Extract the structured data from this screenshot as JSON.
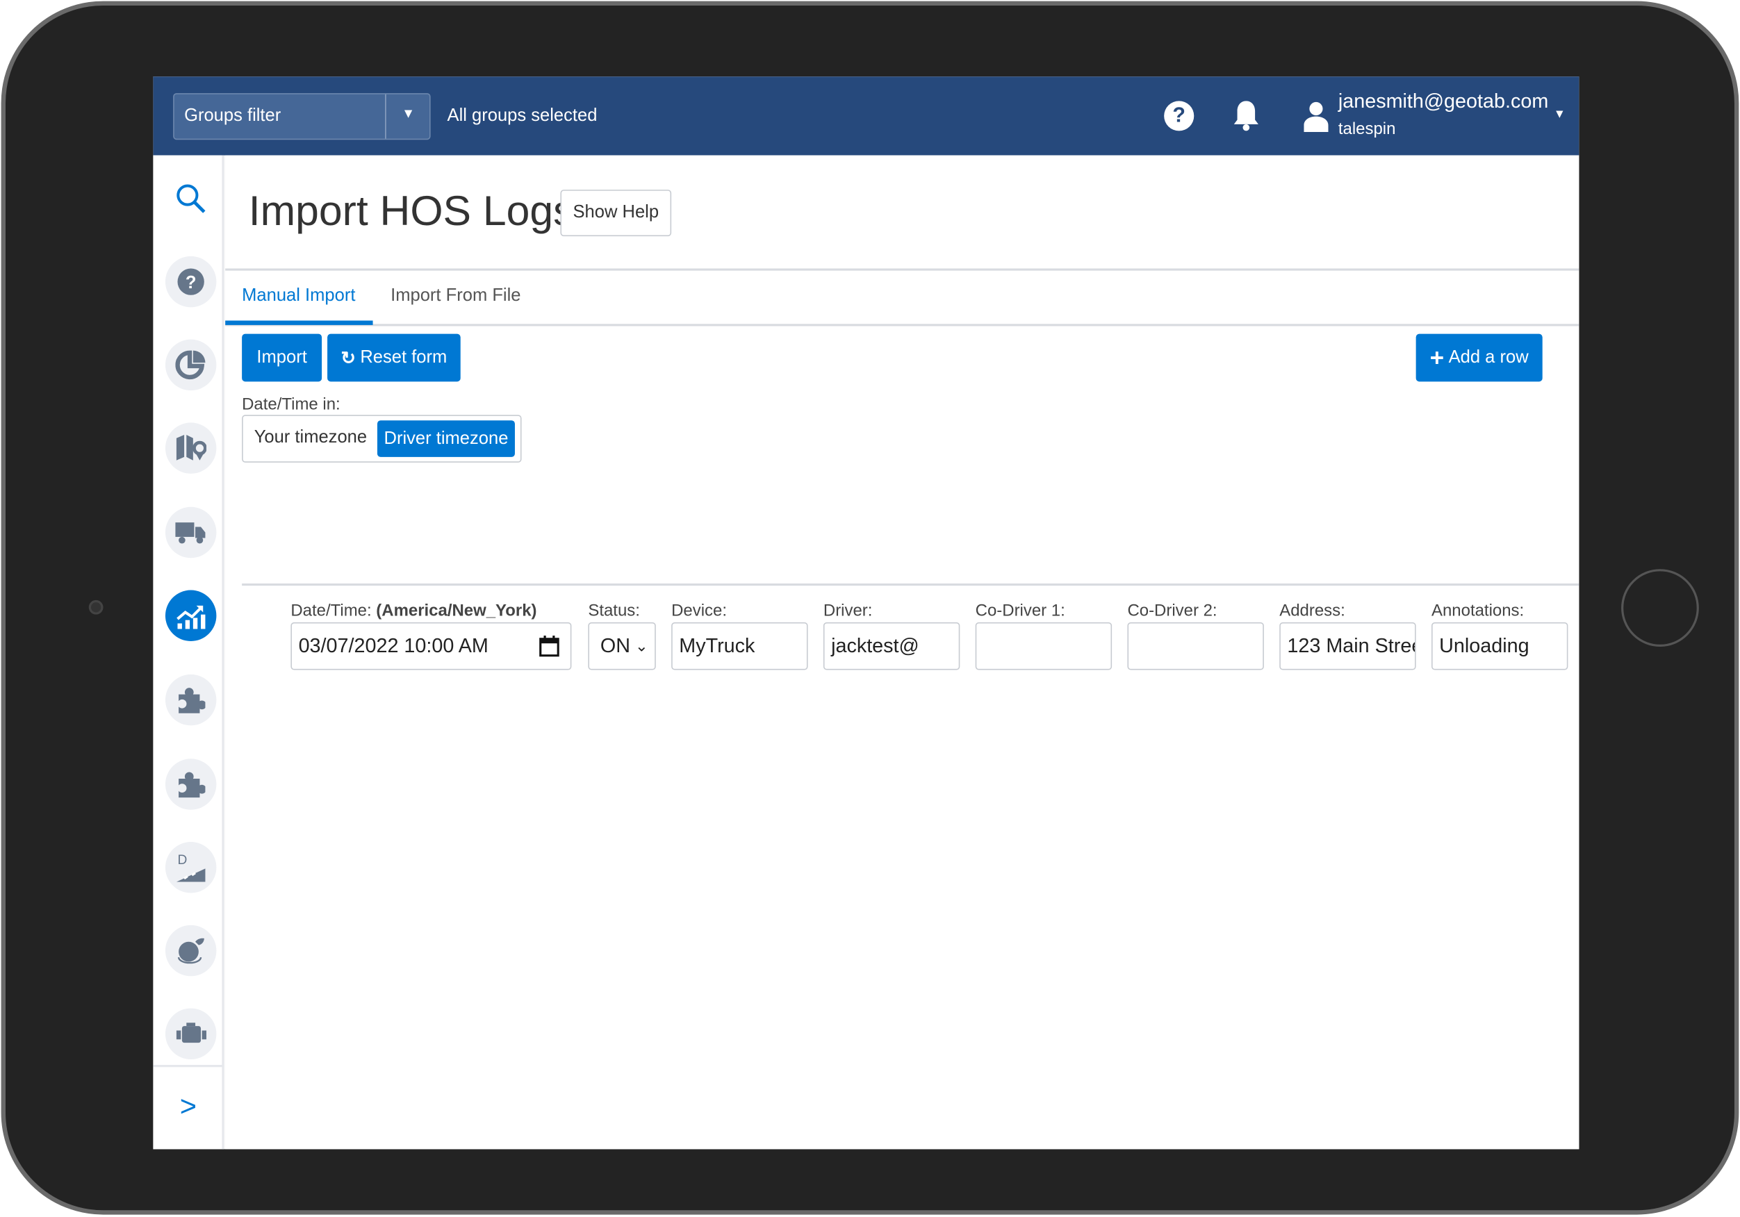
{
  "header": {
    "groups_filter_label": "Groups filter",
    "groups_status": "All groups selected",
    "user_email": "janesmith@geotab.com",
    "user_database": "talespin"
  },
  "sidebar": {
    "items": [
      "search",
      "help",
      "activity",
      "map",
      "vehicles",
      "reports",
      "add-in",
      "add-in",
      "driver-assist",
      "sustainability",
      "engine"
    ],
    "active": "reports",
    "expand_label": ">"
  },
  "page": {
    "title": "Import HOS Logs",
    "show_help": "Show Help"
  },
  "tabs": [
    {
      "label": "Manual Import",
      "active": true
    },
    {
      "label": "Import From File",
      "active": false
    }
  ],
  "toolbar": {
    "import": "Import",
    "reset": "Reset form",
    "add_row": "Add a row"
  },
  "timezone": {
    "label": "Date/Time in:",
    "options": [
      "Your timezone",
      "Driver timezone"
    ],
    "selected": "Driver timezone"
  },
  "row": {
    "datetime_label": "Date/Time:",
    "datetime_tz": "(America/New_York)",
    "datetime_value": "03/07/2022 10:00 AM",
    "status_label": "Status:",
    "status_value": "ON",
    "device_label": "Device:",
    "device_value": "MyTruck",
    "driver_label": "Driver:",
    "driver_value": "jacktest@",
    "codriver1_label": "Co-Driver 1:",
    "codriver1_value": "",
    "codriver2_label": "Co-Driver 2:",
    "codriver2_value": "",
    "address_label": "Address:",
    "address_value": "123 Main Stree",
    "annotations_label": "Annotations:",
    "annotations_value": "Unloading"
  },
  "colors": {
    "header": "#26497c",
    "accent": "#0078d3"
  }
}
